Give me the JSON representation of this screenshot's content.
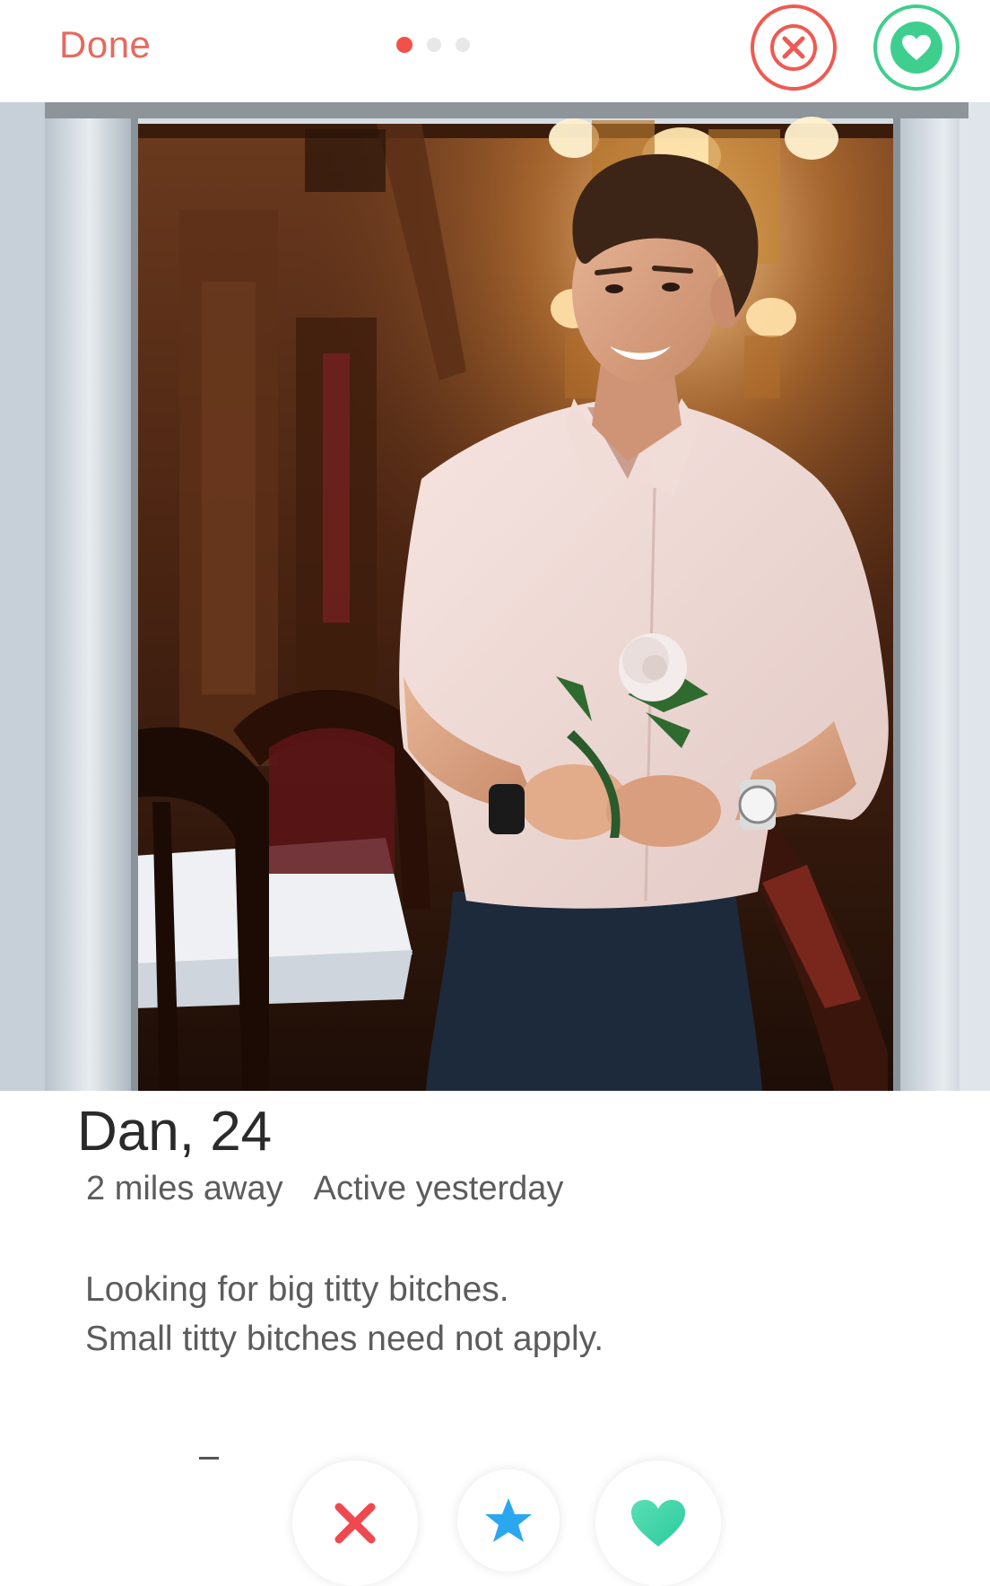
{
  "header": {
    "done_label": "Done",
    "photo_pager": {
      "count": 3,
      "active_index": 0
    }
  },
  "profile": {
    "name_age": "Dan, 24",
    "distance": "2 miles away",
    "last_active": "Active yesterday",
    "bio_lines": [
      "Looking for big titty bitches.",
      "Small titty bitches need not apply."
    ]
  },
  "actions": {
    "top": [
      "close-circle-icon",
      "heart-circle-icon"
    ],
    "bottom": [
      "nope-x-icon",
      "super-like-star-icon",
      "like-heart-icon"
    ]
  },
  "colors": {
    "nope": "#ee5a52",
    "done": "#e56a5f",
    "like": "#3ecf8e",
    "super_like": "#2ba7ef",
    "text_primary": "#2a2a2a",
    "text_secondary": "#5c5c5c"
  }
}
